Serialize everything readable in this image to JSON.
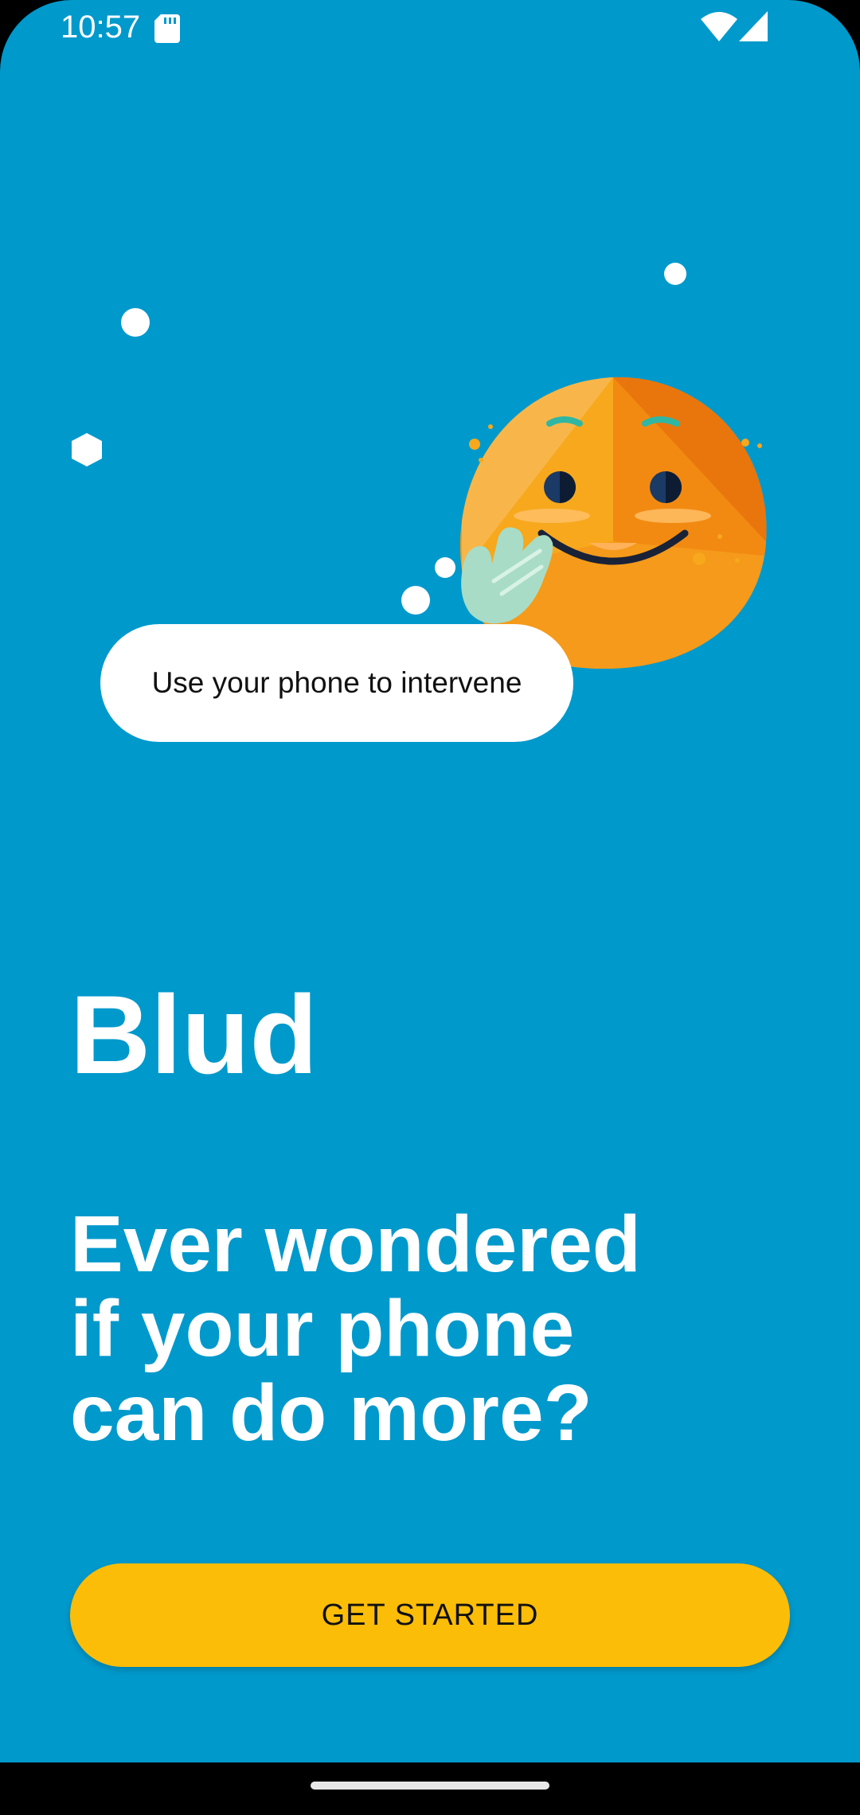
{
  "status_bar": {
    "time": "10:57",
    "icons": [
      "sd-card-icon",
      "wifi-icon",
      "cellular-signal-icon"
    ]
  },
  "illustration": {
    "mascot": "smiling-orange-blob-mascot",
    "bubble_text": "Use your phone to intervene"
  },
  "app_name": "Blud",
  "headline_lines": [
    "Ever wondered",
    "if your phone",
    "can do more?"
  ],
  "cta": {
    "label": "GET STARTED"
  },
  "colors": {
    "background": "#0099cc",
    "accent": "#fcbd08",
    "mascot_orange": "#f59a1a"
  }
}
